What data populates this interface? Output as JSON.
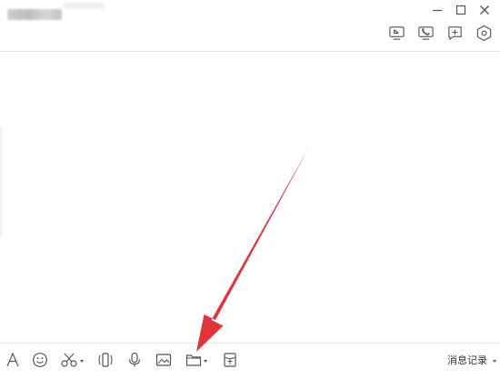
{
  "window": {
    "controls": {
      "minimize": "minimize-icon",
      "maximize": "maximize-icon",
      "close": "close-icon"
    }
  },
  "header_tools": [
    {
      "id": "screen-share",
      "icon": "screen-share-icon"
    },
    {
      "id": "voice-call",
      "icon": "phone-icon"
    },
    {
      "id": "add",
      "icon": "add-chat-icon"
    },
    {
      "id": "settings",
      "icon": "hexagon-settings-icon"
    }
  ],
  "toolbar": {
    "items": [
      {
        "id": "font",
        "icon": "font-icon"
      },
      {
        "id": "emoji",
        "icon": "emoji-icon"
      },
      {
        "id": "screenshot",
        "icon": "scissors-icon",
        "dropdown": true
      },
      {
        "id": "shake",
        "icon": "shake-icon"
      },
      {
        "id": "voice",
        "icon": "microphone-icon"
      },
      {
        "id": "image",
        "icon": "image-icon"
      },
      {
        "id": "file",
        "icon": "folder-icon",
        "dropdown": true
      },
      {
        "id": "red-packet",
        "icon": "red-packet-icon"
      }
    ],
    "history_label": "消息记录"
  },
  "annotation": {
    "color": "#e0343a",
    "points_to": "file"
  }
}
